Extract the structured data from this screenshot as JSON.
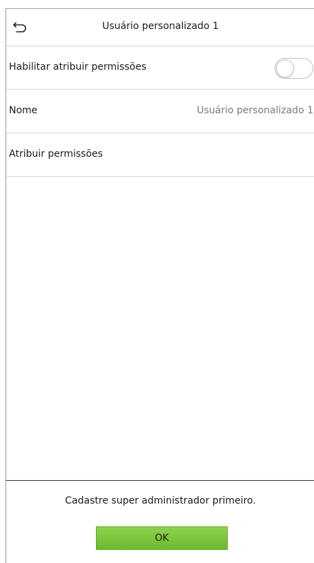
{
  "header": {
    "title": "Usuário personalizado 1",
    "back_icon": "back-arrow-icon"
  },
  "rows": [
    {
      "label": "Habilitar atribuir permissões",
      "toggle_state": "off"
    },
    {
      "label": "Nome",
      "value": "Usuário personalizado 1"
    },
    {
      "label": "Atribuir permissões"
    }
  ],
  "dialog": {
    "message": "Cadastre super administrador primeiro.",
    "ok_label": "OK",
    "ok_color": "#7cc63b"
  }
}
